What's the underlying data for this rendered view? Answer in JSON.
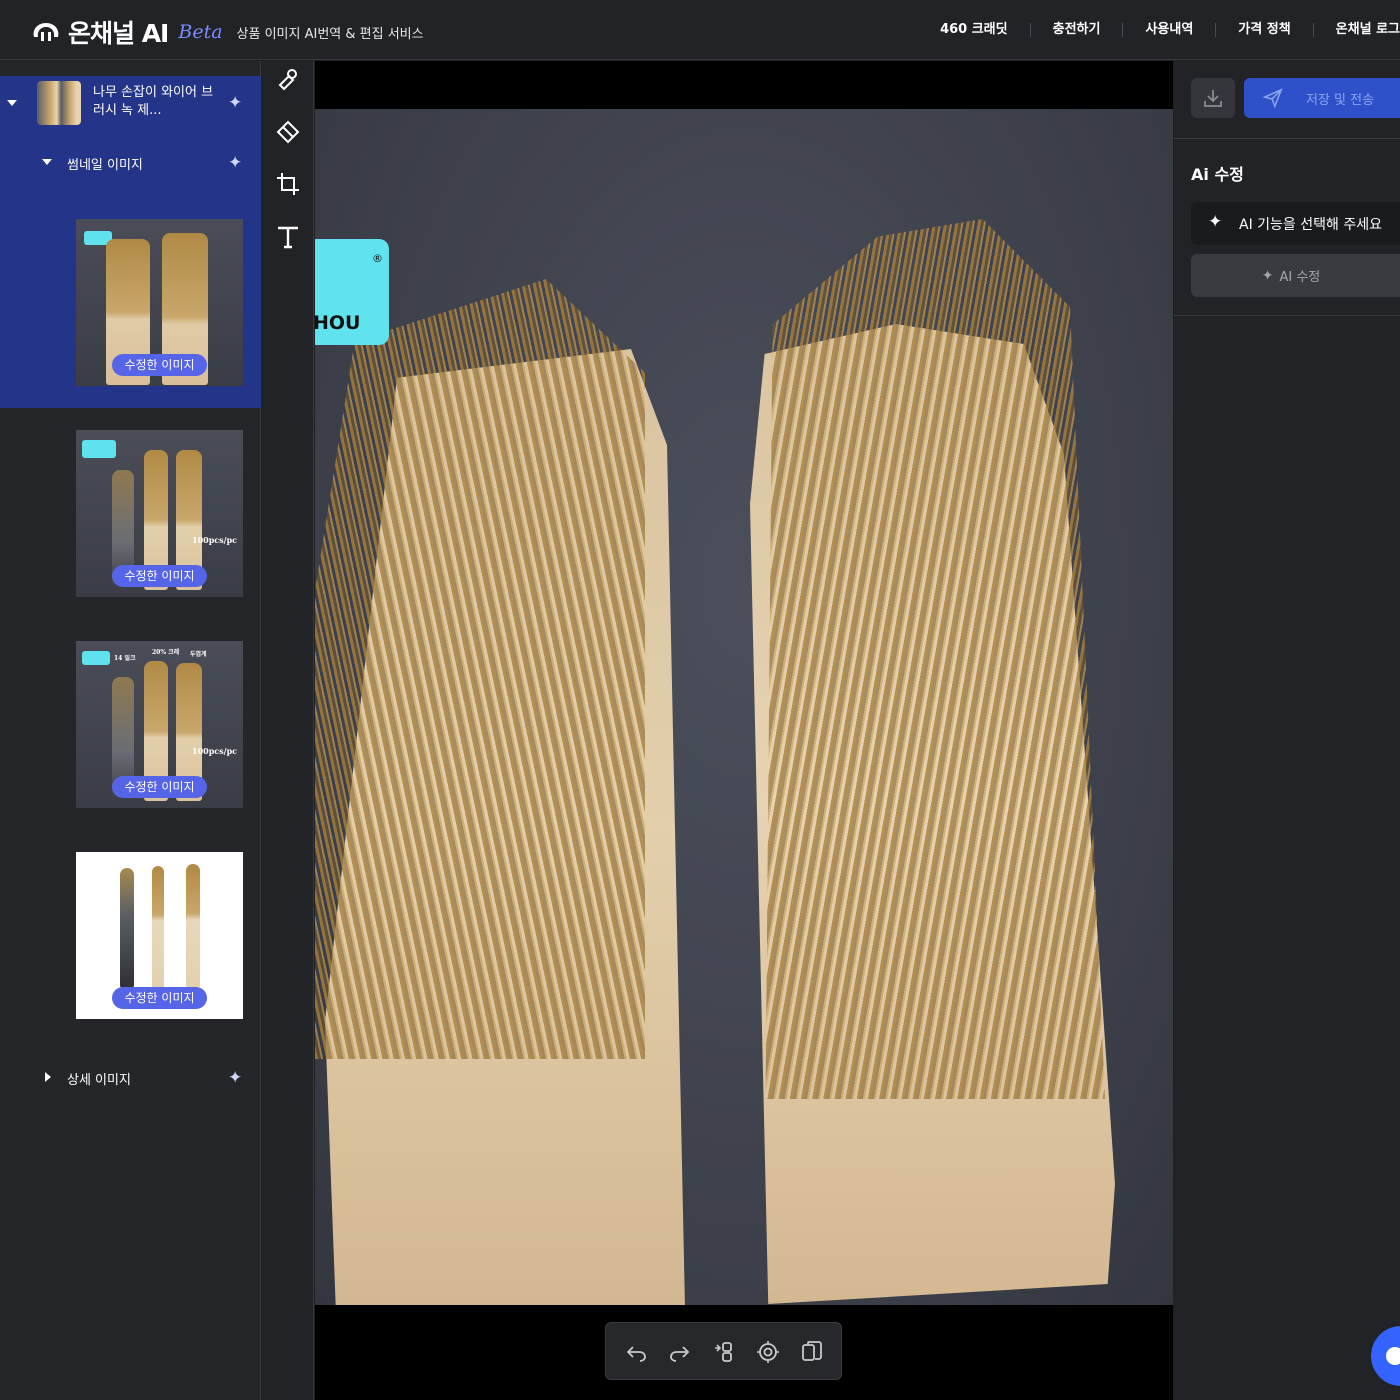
{
  "header": {
    "brand": "온채널 AI",
    "beta": "Beta",
    "tagline": "상품 이미지 AI번역 & 편집 서비스",
    "nav": [
      "460 크래딧",
      "충전하기",
      "사용내역",
      "가격 정책",
      "온채널 로그"
    ]
  },
  "sidebar": {
    "product_title": "나무 손잡이 와이어 브러시 녹 제...",
    "thumbnail_section": "썸네일 이미지",
    "detail_section": "상세 이미지",
    "thumbnails": [
      {
        "badge": "수정한 이미지"
      },
      {
        "badge": "수정한 이미지",
        "text": "100pcs/pc"
      },
      {
        "badge": "수정한 이미지",
        "text": "100pcs/pc",
        "top_texts": [
          "14 일크",
          "20% 크레",
          "두껍게"
        ]
      },
      {
        "badge": "수정한 이미지"
      }
    ]
  },
  "canvas": {
    "brand_tag_text": "HOU",
    "registered_mark": "®"
  },
  "right_panel": {
    "save_label": "저장 및 전송",
    "title": "Ai 수정",
    "select_placeholder": "AI 기능을 선택해 주세요",
    "ai_button": "AI 수정"
  },
  "icons": {
    "tools": [
      "eraser-pen-icon",
      "eraser-icon",
      "crop-icon",
      "text-icon"
    ],
    "canvas_toolbar": [
      "undo-icon",
      "redo-icon",
      "compare-icon",
      "target-icon",
      "copy-icon"
    ]
  },
  "colors": {
    "selected": "#233489",
    "accent": "#5665e8",
    "save": "#2e50c9",
    "brand_tag": "#60e3ef"
  }
}
